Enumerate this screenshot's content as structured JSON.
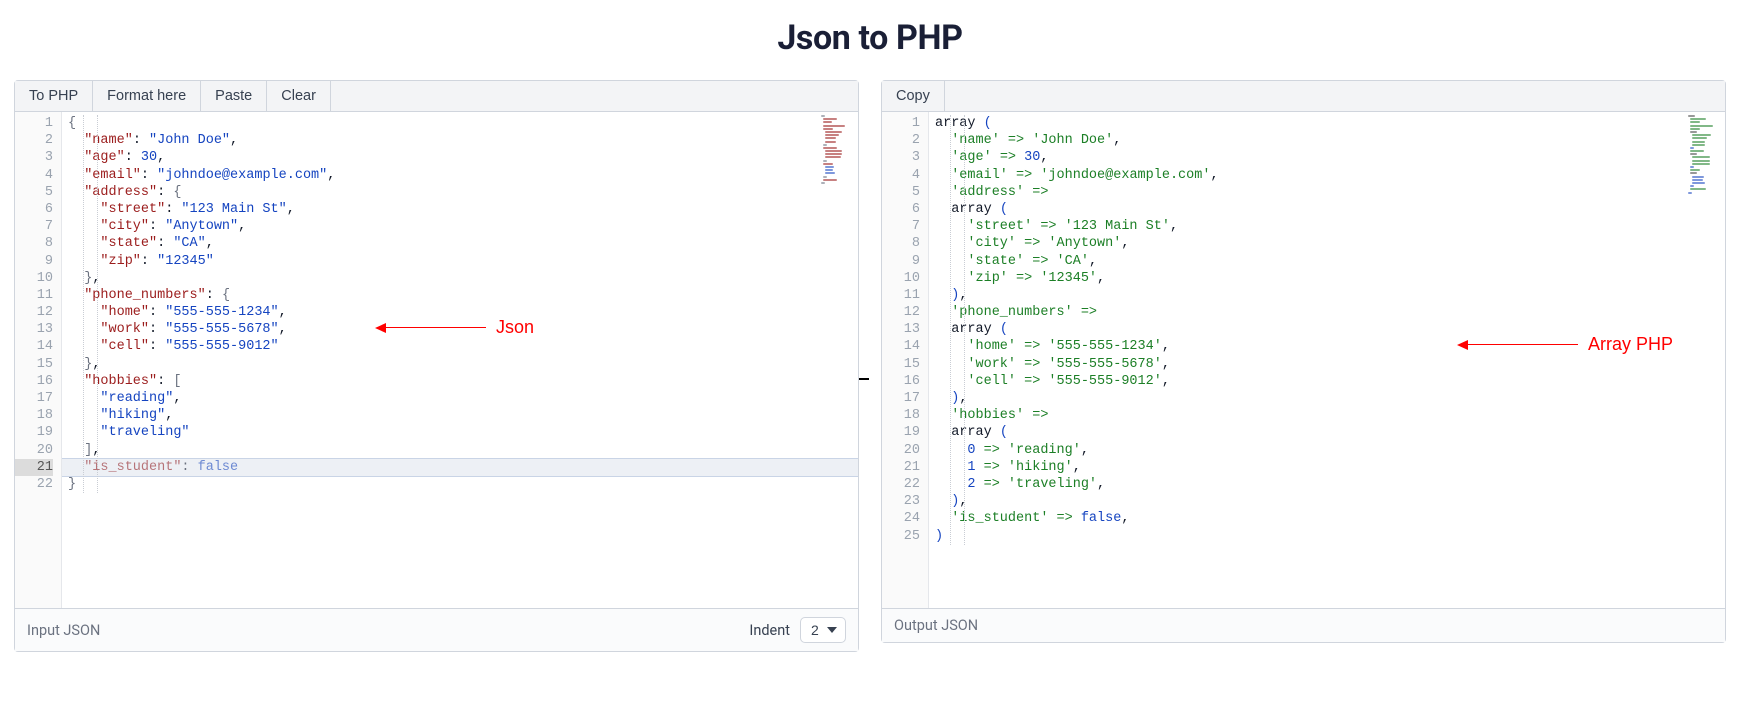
{
  "title": "Json to PHP",
  "toolbar_left": {
    "to_php": "To PHP",
    "format_here": "Format here",
    "paste": "Paste",
    "clear": "Clear"
  },
  "toolbar_right": {
    "copy": "Copy"
  },
  "footer_left": {
    "label": "Input JSON",
    "indent_label": "Indent",
    "indent_value": "2"
  },
  "footer_right": {
    "label": "Output JSON"
  },
  "annotation_left": "Json",
  "annotation_right": "Array PHP",
  "left_active_line": 21,
  "json_lines": [
    [
      {
        "t": "brace",
        "v": "{"
      }
    ],
    [
      {
        "t": "ind",
        "n": 1
      },
      {
        "t": "key",
        "v": "\"name\""
      },
      {
        "t": "punc",
        "v": ": "
      },
      {
        "t": "str",
        "v": "\"John Doe\""
      },
      {
        "t": "punc",
        "v": ","
      }
    ],
    [
      {
        "t": "ind",
        "n": 1
      },
      {
        "t": "key",
        "v": "\"age\""
      },
      {
        "t": "punc",
        "v": ": "
      },
      {
        "t": "num",
        "v": "30"
      },
      {
        "t": "punc",
        "v": ","
      }
    ],
    [
      {
        "t": "ind",
        "n": 1
      },
      {
        "t": "key",
        "v": "\"email\""
      },
      {
        "t": "punc",
        "v": ": "
      },
      {
        "t": "str",
        "v": "\"johndoe@example.com\""
      },
      {
        "t": "punc",
        "v": ","
      }
    ],
    [
      {
        "t": "ind",
        "n": 1
      },
      {
        "t": "key",
        "v": "\"address\""
      },
      {
        "t": "punc",
        "v": ": "
      },
      {
        "t": "brace",
        "v": "{"
      }
    ],
    [
      {
        "t": "ind",
        "n": 2
      },
      {
        "t": "key",
        "v": "\"street\""
      },
      {
        "t": "punc",
        "v": ": "
      },
      {
        "t": "str",
        "v": "\"123 Main St\""
      },
      {
        "t": "punc",
        "v": ","
      }
    ],
    [
      {
        "t": "ind",
        "n": 2
      },
      {
        "t": "key",
        "v": "\"city\""
      },
      {
        "t": "punc",
        "v": ": "
      },
      {
        "t": "str",
        "v": "\"Anytown\""
      },
      {
        "t": "punc",
        "v": ","
      }
    ],
    [
      {
        "t": "ind",
        "n": 2
      },
      {
        "t": "key",
        "v": "\"state\""
      },
      {
        "t": "punc",
        "v": ": "
      },
      {
        "t": "str",
        "v": "\"CA\""
      },
      {
        "t": "punc",
        "v": ","
      }
    ],
    [
      {
        "t": "ind",
        "n": 2
      },
      {
        "t": "key",
        "v": "\"zip\""
      },
      {
        "t": "punc",
        "v": ": "
      },
      {
        "t": "str",
        "v": "\"12345\""
      }
    ],
    [
      {
        "t": "ind",
        "n": 1
      },
      {
        "t": "brace",
        "v": "}"
      },
      {
        "t": "punc",
        "v": ","
      }
    ],
    [
      {
        "t": "ind",
        "n": 1
      },
      {
        "t": "key",
        "v": "\"phone_numbers\""
      },
      {
        "t": "punc",
        "v": ": "
      },
      {
        "t": "brace",
        "v": "{"
      }
    ],
    [
      {
        "t": "ind",
        "n": 2
      },
      {
        "t": "key",
        "v": "\"home\""
      },
      {
        "t": "punc",
        "v": ": "
      },
      {
        "t": "str",
        "v": "\"555-555-1234\""
      },
      {
        "t": "punc",
        "v": ","
      }
    ],
    [
      {
        "t": "ind",
        "n": 2
      },
      {
        "t": "key",
        "v": "\"work\""
      },
      {
        "t": "punc",
        "v": ": "
      },
      {
        "t": "str",
        "v": "\"555-555-5678\""
      },
      {
        "t": "punc",
        "v": ","
      }
    ],
    [
      {
        "t": "ind",
        "n": 2
      },
      {
        "t": "key",
        "v": "\"cell\""
      },
      {
        "t": "punc",
        "v": ": "
      },
      {
        "t": "str",
        "v": "\"555-555-9012\""
      }
    ],
    [
      {
        "t": "ind",
        "n": 1
      },
      {
        "t": "brace",
        "v": "}"
      },
      {
        "t": "punc",
        "v": ","
      }
    ],
    [
      {
        "t": "ind",
        "n": 1
      },
      {
        "t": "key",
        "v": "\"hobbies\""
      },
      {
        "t": "punc",
        "v": ": "
      },
      {
        "t": "brace",
        "v": "["
      }
    ],
    [
      {
        "t": "ind",
        "n": 2
      },
      {
        "t": "str",
        "v": "\"reading\""
      },
      {
        "t": "punc",
        "v": ","
      }
    ],
    [
      {
        "t": "ind",
        "n": 2
      },
      {
        "t": "str",
        "v": "\"hiking\""
      },
      {
        "t": "punc",
        "v": ","
      }
    ],
    [
      {
        "t": "ind",
        "n": 2
      },
      {
        "t": "str",
        "v": "\"traveling\""
      }
    ],
    [
      {
        "t": "ind",
        "n": 1
      },
      {
        "t": "brace",
        "v": "]"
      },
      {
        "t": "punc",
        "v": ","
      }
    ],
    [
      {
        "t": "ind",
        "n": 1
      },
      {
        "t": "key",
        "v": "\"is_student\""
      },
      {
        "t": "punc",
        "v": ": "
      },
      {
        "t": "bool",
        "v": "false"
      }
    ],
    [
      {
        "t": "brace",
        "v": "}"
      }
    ]
  ],
  "php_lines": [
    [
      {
        "t": "kw",
        "v": "array "
      },
      {
        "t": "paren",
        "v": "("
      }
    ],
    [
      {
        "t": "ind",
        "n": 1
      },
      {
        "t": "pkey",
        "v": "'name'"
      },
      {
        "t": "arrow",
        "v": " => "
      },
      {
        "t": "pkey",
        "v": "'John Doe'"
      },
      {
        "t": "punc",
        "v": ","
      }
    ],
    [
      {
        "t": "ind",
        "n": 1
      },
      {
        "t": "pkey",
        "v": "'age'"
      },
      {
        "t": "arrow",
        "v": " => "
      },
      {
        "t": "num",
        "v": "30"
      },
      {
        "t": "punc",
        "v": ","
      }
    ],
    [
      {
        "t": "ind",
        "n": 1
      },
      {
        "t": "pkey",
        "v": "'email'"
      },
      {
        "t": "arrow",
        "v": " => "
      },
      {
        "t": "pkey",
        "v": "'johndoe@example.com'"
      },
      {
        "t": "punc",
        "v": ","
      }
    ],
    [
      {
        "t": "ind",
        "n": 1
      },
      {
        "t": "pkey",
        "v": "'address'"
      },
      {
        "t": "arrow",
        "v": " =>"
      }
    ],
    [
      {
        "t": "ind",
        "n": 1
      },
      {
        "t": "kw",
        "v": "array "
      },
      {
        "t": "paren",
        "v": "("
      }
    ],
    [
      {
        "t": "ind",
        "n": 2
      },
      {
        "t": "pkey",
        "v": "'street'"
      },
      {
        "t": "arrow",
        "v": " => "
      },
      {
        "t": "pkey",
        "v": "'123 Main St'"
      },
      {
        "t": "punc",
        "v": ","
      }
    ],
    [
      {
        "t": "ind",
        "n": 2
      },
      {
        "t": "pkey",
        "v": "'city'"
      },
      {
        "t": "arrow",
        "v": " => "
      },
      {
        "t": "pkey",
        "v": "'Anytown'"
      },
      {
        "t": "punc",
        "v": ","
      }
    ],
    [
      {
        "t": "ind",
        "n": 2
      },
      {
        "t": "pkey",
        "v": "'state'"
      },
      {
        "t": "arrow",
        "v": " => "
      },
      {
        "t": "pkey",
        "v": "'CA'"
      },
      {
        "t": "punc",
        "v": ","
      }
    ],
    [
      {
        "t": "ind",
        "n": 2
      },
      {
        "t": "pkey",
        "v": "'zip'"
      },
      {
        "t": "arrow",
        "v": " => "
      },
      {
        "t": "pkey",
        "v": "'12345'"
      },
      {
        "t": "punc",
        "v": ","
      }
    ],
    [
      {
        "t": "ind",
        "n": 1
      },
      {
        "t": "paren",
        "v": ")"
      },
      {
        "t": "punc",
        "v": ","
      }
    ],
    [
      {
        "t": "ind",
        "n": 1
      },
      {
        "t": "pkey",
        "v": "'phone_numbers'"
      },
      {
        "t": "arrow",
        "v": " =>"
      }
    ],
    [
      {
        "t": "ind",
        "n": 1
      },
      {
        "t": "kw",
        "v": "array "
      },
      {
        "t": "paren",
        "v": "("
      }
    ],
    [
      {
        "t": "ind",
        "n": 2
      },
      {
        "t": "pkey",
        "v": "'home'"
      },
      {
        "t": "arrow",
        "v": " => "
      },
      {
        "t": "pkey",
        "v": "'555-555-1234'"
      },
      {
        "t": "punc",
        "v": ","
      }
    ],
    [
      {
        "t": "ind",
        "n": 2
      },
      {
        "t": "pkey",
        "v": "'work'"
      },
      {
        "t": "arrow",
        "v": " => "
      },
      {
        "t": "pkey",
        "v": "'555-555-5678'"
      },
      {
        "t": "punc",
        "v": ","
      }
    ],
    [
      {
        "t": "ind",
        "n": 2
      },
      {
        "t": "pkey",
        "v": "'cell'"
      },
      {
        "t": "arrow",
        "v": " => "
      },
      {
        "t": "pkey",
        "v": "'555-555-9012'"
      },
      {
        "t": "punc",
        "v": ","
      }
    ],
    [
      {
        "t": "ind",
        "n": 1
      },
      {
        "t": "paren",
        "v": ")"
      },
      {
        "t": "punc",
        "v": ","
      }
    ],
    [
      {
        "t": "ind",
        "n": 1
      },
      {
        "t": "pkey",
        "v": "'hobbies'"
      },
      {
        "t": "arrow",
        "v": " =>"
      }
    ],
    [
      {
        "t": "ind",
        "n": 1
      },
      {
        "t": "kw",
        "v": "array "
      },
      {
        "t": "paren",
        "v": "("
      }
    ],
    [
      {
        "t": "ind",
        "n": 2
      },
      {
        "t": "num",
        "v": "0"
      },
      {
        "t": "arrow",
        "v": " => "
      },
      {
        "t": "pkey",
        "v": "'reading'"
      },
      {
        "t": "punc",
        "v": ","
      }
    ],
    [
      {
        "t": "ind",
        "n": 2
      },
      {
        "t": "num",
        "v": "1"
      },
      {
        "t": "arrow",
        "v": " => "
      },
      {
        "t": "pkey",
        "v": "'hiking'"
      },
      {
        "t": "punc",
        "v": ","
      }
    ],
    [
      {
        "t": "ind",
        "n": 2
      },
      {
        "t": "num",
        "v": "2"
      },
      {
        "t": "arrow",
        "v": " => "
      },
      {
        "t": "pkey",
        "v": "'traveling'"
      },
      {
        "t": "punc",
        "v": ","
      }
    ],
    [
      {
        "t": "ind",
        "n": 1
      },
      {
        "t": "paren",
        "v": ")"
      },
      {
        "t": "punc",
        "v": ","
      }
    ],
    [
      {
        "t": "ind",
        "n": 1
      },
      {
        "t": "pkey",
        "v": "'is_student'"
      },
      {
        "t": "arrow",
        "v": " => "
      },
      {
        "t": "bool",
        "v": "false"
      },
      {
        "t": "punc",
        "v": ","
      }
    ],
    [
      {
        "t": "paren",
        "v": ")"
      }
    ]
  ]
}
